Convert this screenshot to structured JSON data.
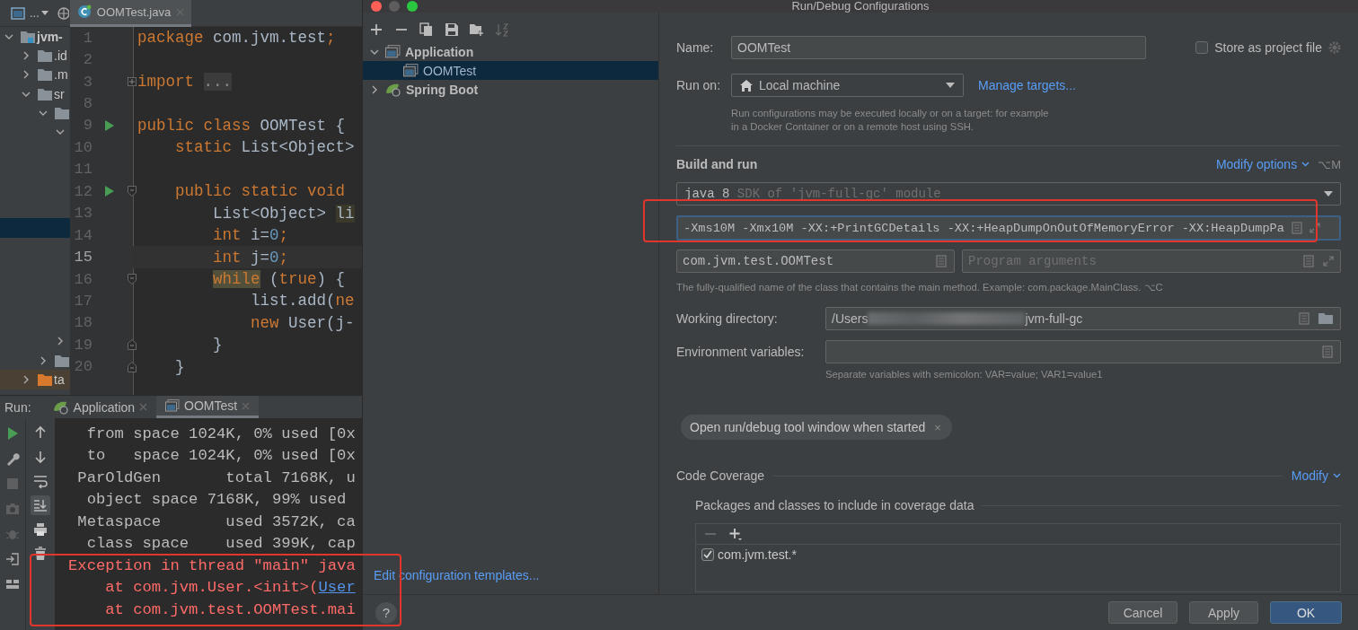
{
  "ide": {
    "toolbar": {
      "view_menu": "..."
    },
    "editor_tab": {
      "label": "OOMTest.java",
      "selected": true
    },
    "project_tree": {
      "items": [
        {
          "label": "jvm-",
          "kind": "module",
          "expanded": true,
          "selected": false,
          "children": [
            {
              "label": ".id",
              "kind": "folder",
              "expanded": false,
              "selected": false
            },
            {
              "label": ".m",
              "kind": "folder",
              "expanded": false,
              "selected": false
            },
            {
              "label": "sr",
              "kind": "folder",
              "expanded": true,
              "selected": false,
              "children": [
                {
                  "kind": "folder",
                  "expanded": true,
                  "selected": false,
                  "children": [
                    {
                      "expanded": true,
                      "selected": false,
                      "children": [
                        {
                          "selected": true
                        }
                      ]
                    },
                    {
                      "expanded": false,
                      "selected": false
                    }
                  ]
                },
                {
                  "kind": "folder",
                  "expanded": false,
                  "selected": false
                }
              ]
            },
            {
              "label": "ta",
              "kind": "excluded-folder",
              "expanded": false,
              "selected": false
            }
          ]
        }
      ]
    },
    "code_lines": [
      {
        "number": "1",
        "run": false,
        "fold_start": false,
        "fold_end": false,
        "collapsed_fold": false,
        "current": false,
        "segments": [
          {
            "text": "package",
            "kind": "keyword"
          },
          {
            "text": " com.jvm.test",
            "kind": "plain"
          },
          {
            "text": ";",
            "kind": "keyword"
          }
        ]
      },
      {
        "number": "2",
        "run": false,
        "fold_start": false,
        "fold_end": false,
        "collapsed_fold": false,
        "current": false
      },
      {
        "number": "3",
        "run": false,
        "fold_start": false,
        "fold_end": false,
        "collapsed_fold": true,
        "current": false,
        "segments": [
          {
            "text": "import",
            "kind": "keyword"
          },
          {
            "text": " ...",
            "kind": "folded"
          }
        ]
      },
      {
        "number": "8",
        "run": false,
        "fold_start": false,
        "fold_end": false,
        "collapsed_fold": false,
        "current": false
      },
      {
        "number": "9",
        "run": true,
        "fold_start": false,
        "fold_end": false,
        "collapsed_fold": false,
        "current": false,
        "segments": [
          {
            "text": "public class",
            "kind": "keyword"
          },
          {
            "text": " OOMTest {",
            "kind": "plain"
          }
        ]
      },
      {
        "number": "10",
        "run": false,
        "fold_start": false,
        "fold_end": false,
        "collapsed_fold": false,
        "current": false,
        "segments": [
          {
            "text": "    static",
            "kind": "keyword"
          },
          {
            "text": " List<Object>",
            "kind": "plain"
          }
        ]
      },
      {
        "number": "11",
        "run": false,
        "fold_start": false,
        "fold_end": false,
        "collapsed_fold": false,
        "current": false
      },
      {
        "number": "12",
        "run": true,
        "fold_start": true,
        "fold_end": false,
        "collapsed_fold": false,
        "current": false,
        "segments": [
          {
            "text": "    public static void",
            "kind": "keyword"
          }
        ]
      },
      {
        "number": "13",
        "run": false,
        "fold_start": false,
        "fold_end": false,
        "collapsed_fold": false,
        "current": false,
        "segments": [
          {
            "text": "        List<Object>",
            "kind": "plain"
          },
          {
            "text": " li",
            "kind": "plain-marked"
          }
        ]
      },
      {
        "number": "14",
        "run": false,
        "fold_start": false,
        "fold_end": false,
        "collapsed_fold": false,
        "current": false,
        "segments": [
          {
            "text": "        int",
            "kind": "keyword"
          },
          {
            "text": " i=",
            "kind": "plain"
          },
          {
            "text": "0",
            "kind": "number"
          },
          {
            "text": ";",
            "kind": "keyword"
          }
        ]
      },
      {
        "number": "15",
        "run": false,
        "fold_start": false,
        "fold_end": false,
        "collapsed_fold": false,
        "current": true,
        "segments": [
          {
            "text": "        int",
            "kind": "keyword"
          },
          {
            "text": " j=",
            "kind": "plain"
          },
          {
            "text": "0",
            "kind": "number"
          },
          {
            "text": ";",
            "kind": "keyword"
          }
        ]
      },
      {
        "number": "16",
        "run": false,
        "fold_start": true,
        "fold_end": false,
        "collapsed_fold": false,
        "current": false,
        "segments": [
          {
            "text": "        while",
            "kind": "keyword-marked"
          },
          {
            "text": " (",
            "kind": "plain"
          },
          {
            "text": "true",
            "kind": "keyword"
          },
          {
            "text": ") {",
            "kind": "plain"
          }
        ]
      },
      {
        "number": "17",
        "run": false,
        "fold_start": false,
        "fold_end": false,
        "collapsed_fold": false,
        "current": false,
        "segments": [
          {
            "text": "            list.add(",
            "kind": "plain"
          },
          {
            "text": "ne",
            "kind": "keyword"
          }
        ]
      },
      {
        "number": "18",
        "run": false,
        "fold_start": false,
        "fold_end": false,
        "collapsed_fold": false,
        "current": false,
        "segments": [
          {
            "text": "            new",
            "kind": "keyword"
          },
          {
            "text": " User(j-",
            "kind": "plain"
          }
        ]
      },
      {
        "number": "19",
        "run": false,
        "fold_start": false,
        "fold_end": true,
        "collapsed_fold": false,
        "current": false,
        "segments": [
          {
            "text": "        }",
            "kind": "plain"
          }
        ]
      },
      {
        "number": "20",
        "run": false,
        "fold_start": false,
        "fold_end": true,
        "collapsed_fold": false,
        "current": false,
        "segments": [
          {
            "text": "    }",
            "kind": "plain"
          }
        ]
      }
    ],
    "run_panel": {
      "title": "Run:",
      "tabs": [
        {
          "label": "Application",
          "kind": "spring",
          "selected": false
        },
        {
          "label": "OOMTest",
          "kind": "application",
          "selected": true
        }
      ],
      "left_tools": [
        {
          "kind": "run",
          "disabled": false
        },
        {
          "kind": "wrench",
          "disabled": false
        },
        {
          "kind": "stop",
          "disabled": true
        },
        {
          "kind": "camera",
          "disabled": true
        },
        {
          "kind": "bug",
          "disabled": true
        },
        {
          "kind": "exit",
          "disabled": false
        },
        {
          "kind": "layout",
          "disabled": false
        }
      ],
      "right_tools": [
        {
          "kind": "up",
          "on": false
        },
        {
          "kind": "down",
          "on": false
        },
        {
          "kind": "wrap",
          "on": false
        },
        {
          "kind": "scroll-end",
          "on": true
        },
        {
          "kind": "print",
          "on": false
        },
        {
          "kind": "trash",
          "on": false
        }
      ],
      "console": {
        "highlighted": true,
        "lines": [
          {
            "kind": "normal",
            "segments": [
              {
                "text": "  from space 1024K, 0% used [0x",
                "kind": "text"
              }
            ]
          },
          {
            "kind": "normal",
            "segments": [
              {
                "text": "  to   space 1024K, 0% used [0x",
                "kind": "text"
              }
            ]
          },
          {
            "kind": "normal",
            "segments": [
              {
                "text": " ParOldGen       total 7168K, u",
                "kind": "text"
              }
            ]
          },
          {
            "kind": "normal",
            "segments": [
              {
                "text": "  object space 7168K, 99% used",
                "kind": "text"
              }
            ]
          },
          {
            "kind": "normal",
            "segments": [
              {
                "text": " Metaspace       used 3572K, ca",
                "kind": "text"
              }
            ]
          },
          {
            "kind": "normal",
            "segments": [
              {
                "text": "  class space    used 399K, cap",
                "kind": "text"
              }
            ]
          },
          {
            "kind": "error",
            "segments": [
              {
                "text": "Exception in thread \"main\" java",
                "kind": "text"
              }
            ]
          },
          {
            "kind": "error",
            "segments": [
              {
                "text": "    at com.jvm.User.<init>(",
                "kind": "text"
              },
              {
                "text": "User",
                "kind": "link"
              }
            ]
          },
          {
            "kind": "error",
            "segments": [
              {
                "text": "    at com.jvm.test.OOMTest.mai",
                "kind": "text"
              }
            ]
          }
        ]
      }
    }
  },
  "dialog": {
    "title": "Run/Debug Configurations",
    "toolbar": [
      {
        "kind": "add",
        "disabled": false
      },
      {
        "kind": "remove",
        "disabled": false
      },
      {
        "kind": "copy",
        "disabled": false
      },
      {
        "kind": "save",
        "disabled": false
      },
      {
        "kind": "new-folder",
        "disabled": false
      },
      {
        "kind": "sort",
        "disabled": true
      }
    ],
    "tree": [
      {
        "label": "Application",
        "kind": "application",
        "expanded": true,
        "selected": false,
        "children": [
          {
            "label": "OOMTest",
            "kind": "application",
            "selected": true
          }
        ]
      },
      {
        "label": "Spring Boot",
        "kind": "spring",
        "expanded": false,
        "selected": false
      }
    ],
    "templates_link": "Edit configuration templates...",
    "help": "?",
    "form": {
      "name_label": "Name:",
      "name": "OOMTest",
      "store_checkbox": {
        "label": "Store as project file",
        "checked": false
      },
      "run_on_label": "Run on:",
      "run_on": "Local machine",
      "manage_link": "Manage targets...",
      "run_on_hint": "Run configurations may be executed locally or on a target: for example in a Docker Container or on a remote host using SSH.",
      "build_heading": "Build and run",
      "modify_options": "Modify options",
      "modify_shortcut": "⌥M",
      "jre": {
        "value": "java 8",
        "hint": "SDK of 'jvm-full-gc' module"
      },
      "vm_options": {
        "value": "-Xms10M -Xmx10M -XX:+PrintGCDetails -XX:+HeapDumpOnOutOfMemoryError -XX:HeapDumpPa",
        "focused": true,
        "highlighted": true
      },
      "main_class": "com.jvm.test.OOMTest",
      "program_args_placeholder": "Program arguments",
      "main_class_hint": "The fully-qualified name of the class that contains the main method. Example: com.package.MainClass. ⌥C",
      "working_dir": {
        "label": "Working directory:",
        "start": "/Users",
        "end": "jvm-full-gc",
        "redacted": true
      },
      "env": {
        "label": "Environment variables:",
        "hint": "Separate variables with semicolon: VAR=value; VAR1=value1"
      },
      "chips": [
        {
          "label": "Open run/debug tool window when started",
          "close": "×"
        }
      ],
      "coverage": {
        "heading": "Code Coverage",
        "modify": "Modify",
        "subheading": "Packages and classes to include in coverage data",
        "tools": [
          {
            "kind": "remove",
            "disabled": true
          },
          {
            "kind": "add",
            "disabled": false
          }
        ],
        "patterns": [
          {
            "label": "com.jvm.test.*",
            "checked": true
          }
        ]
      }
    },
    "buttons": [
      {
        "label": "Cancel",
        "kind": "normal"
      },
      {
        "label": "Apply",
        "kind": "normal"
      },
      {
        "label": "OK",
        "kind": "default"
      }
    ]
  }
}
